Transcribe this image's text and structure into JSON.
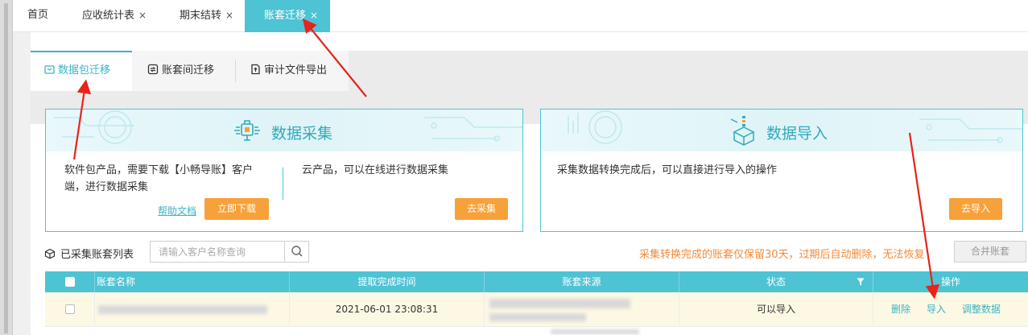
{
  "tabs": [
    {
      "label": "首页",
      "closable": false,
      "active": false
    },
    {
      "label": "应收统计表",
      "closable": true,
      "active": false
    },
    {
      "label": "期末结转",
      "closable": true,
      "active": false
    },
    {
      "label": "账套迁移",
      "closable": true,
      "active": true
    }
  ],
  "close_glyph": "×",
  "inner_tabs": [
    {
      "label": "数据包迁移",
      "icon": "package-icon",
      "active": true
    },
    {
      "label": "账套间迁移",
      "icon": "transfer-icon",
      "active": false
    },
    {
      "label": "审计文件导出",
      "icon": "export-file-icon",
      "active": false
    }
  ],
  "collect_card": {
    "title": "数据采集",
    "left_text_line1": "软件包产品，需要下载【小畅导账】客户",
    "left_text_line2": "端，进行数据采集",
    "right_text": "云产品，可以在线进行数据采集",
    "help_link": "帮助文档",
    "download_button": "立即下载",
    "collect_button": "去采集"
  },
  "import_card": {
    "title": "数据导入",
    "text": "采集数据转换完成后，可以直接进行导入的操作",
    "import_button": "去导入"
  },
  "list": {
    "label": "已采集账套列表",
    "search_placeholder": "请输入客户名称查询",
    "notice": "采集转换完成的账套仅保留30天，过期后自动删除，无法恢复",
    "merge_button": "合并账套"
  },
  "table": {
    "columns": [
      "账套名称",
      "提取完成时间",
      "账套来源",
      "状态",
      "操作"
    ],
    "rows": [
      {
        "name": "",
        "time": "2021-06-01 23:08:31",
        "source": "",
        "status": "可以导入",
        "actions": [
          "删除",
          "导入",
          "调整数据"
        ]
      }
    ]
  },
  "colors": {
    "accent": "#4ec3d4",
    "accent_dark": "#3ab4c6",
    "orange": "#f7a13a",
    "notice": "#f08a3a",
    "arrow": "#e8231a"
  }
}
